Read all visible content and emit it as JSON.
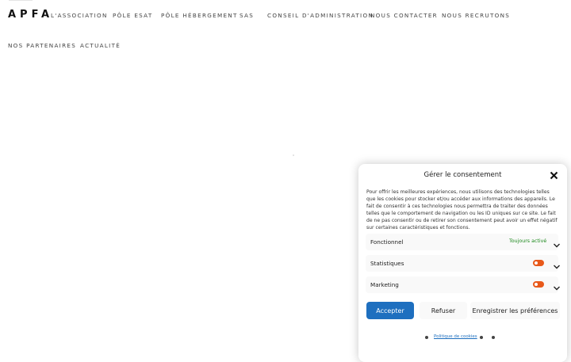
{
  "header": {
    "logo": "APFA",
    "nav": [
      "L'ASSOCIATION",
      "PÔLE ESAT",
      "PÔLE HÉBERGEMENT",
      "SAS",
      "CONSEIL D'ADMINISTRATION",
      "NOUS CONTACTER",
      "NOUS RECRUTONS",
      "NOS PARTENAIRES",
      "ACTUALITÉ"
    ]
  },
  "consent": {
    "title": "Gérer le consentement",
    "description": "Pour offrir les meilleures expériences, nous utilisons des technologies telles que les cookies pour stocker et/ou accéder aux informations des appareils. Le fait de consentir à ces technologies nous permettra de traiter des données telles que le comportement de navigation ou les ID uniques sur ce site. Le fait de ne pas consentir ou de retirer son consentement peut avoir un effet négatif sur certaines caractéristiques et fonctions.",
    "categories": [
      {
        "label": "Fonctionnel",
        "status": "Toujours activé"
      },
      {
        "label": "Statistiques",
        "toggle_color": "#e8591a"
      },
      {
        "label": "Marketing",
        "toggle_color": "#e8591a"
      }
    ],
    "buttons": {
      "accept": "Accepter",
      "refuse": "Refuser",
      "save": "Enregistrer les préférences"
    },
    "policy_link": "Politique de cookies",
    "accent_color": "#1e6fbf"
  }
}
